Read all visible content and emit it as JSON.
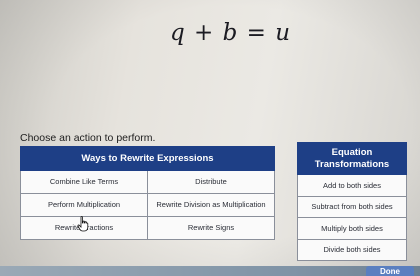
{
  "equation": "q + b = u",
  "prompt": "Choose an action to perform.",
  "rewrite_table": {
    "header": "Ways to Rewrite Expressions",
    "rows": [
      [
        "Combine Like Terms",
        "Distribute"
      ],
      [
        "Perform Multiplication",
        "Rewrite Division as Multiplication"
      ],
      [
        "Rewrite Fractions",
        "Rewrite Signs"
      ]
    ]
  },
  "equation_table": {
    "header": "Equation Transformations",
    "rows": [
      "Add to both sides",
      "Subtract from both sides",
      "Multiply both sides",
      "Divide both sides"
    ]
  },
  "done_label": "Done",
  "colors": {
    "header_bg": "#1e3f86",
    "done_bg": "#5a7fc0"
  }
}
